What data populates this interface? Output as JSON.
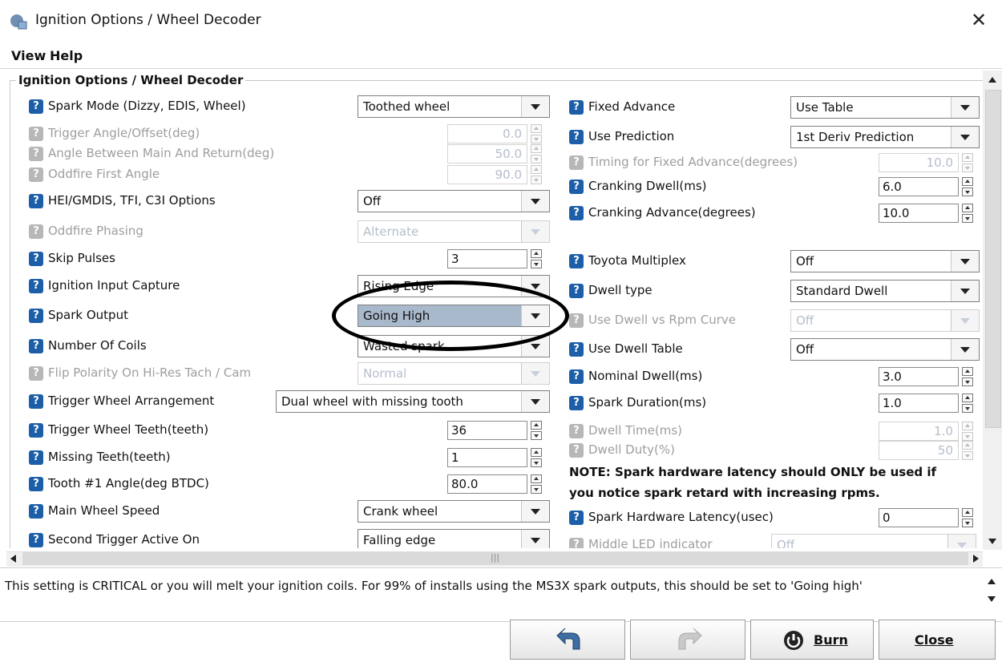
{
  "window": {
    "title": "Ignition Options / Wheel Decoder",
    "close_glyph": "✕"
  },
  "menu": [
    "View",
    "Help"
  ],
  "group_title": "Ignition Options / Wheel Decoder",
  "left": [
    {
      "label": "Spark Mode (Dizzy, EDIS, Wheel)",
      "type": "combo",
      "value": "Toothed wheel",
      "enabled": true
    },
    {
      "label": "Trigger Angle/Offset(deg)",
      "type": "spin",
      "value": "0.0",
      "enabled": false
    },
    {
      "label": "Angle Between Main And Return(deg)",
      "type": "spin",
      "value": "50.0",
      "enabled": false
    },
    {
      "label": "Oddfire First Angle",
      "type": "spin",
      "value": "90.0",
      "enabled": false
    },
    {
      "label": "HEI/GMDIS, TFI, C3I Options",
      "type": "combo",
      "value": "Off",
      "enabled": true
    },
    {
      "label": "Oddfire Phasing",
      "type": "combo",
      "value": "Alternate",
      "enabled": false
    },
    {
      "label": "Skip Pulses",
      "type": "spin",
      "value": "3",
      "enabled": true
    },
    {
      "label": "Ignition Input Capture",
      "type": "combo",
      "value": "Rising Edge",
      "enabled": true
    },
    {
      "label": "Spark Output",
      "type": "combo",
      "value": "Going High",
      "enabled": true
    },
    {
      "label": "Number Of Coils",
      "type": "combo",
      "value": "Wasted spark",
      "enabled": true
    },
    {
      "label": "Flip Polarity On Hi-Res Tach / Cam",
      "type": "combo",
      "value": "Normal",
      "enabled": false
    },
    {
      "label": "Trigger Wheel Arrangement",
      "type": "combo",
      "value": "Dual wheel with missing tooth",
      "enabled": true
    },
    {
      "label": "Trigger Wheel Teeth(teeth)",
      "type": "spin",
      "value": "36",
      "enabled": true
    },
    {
      "label": "Missing Teeth(teeth)",
      "type": "spin",
      "value": "1",
      "enabled": true
    },
    {
      "label": "Tooth #1 Angle(deg BTDC)",
      "type": "spin",
      "value": "80.0",
      "enabled": true
    },
    {
      "label": "Main Wheel Speed",
      "type": "combo",
      "value": "Crank wheel",
      "enabled": true
    },
    {
      "label": "Second Trigger Active On",
      "type": "combo",
      "value": "Falling edge",
      "enabled": true
    }
  ],
  "right": [
    {
      "label": "Fixed Advance",
      "type": "combo",
      "value": "Use Table",
      "enabled": true
    },
    {
      "label": "Use Prediction",
      "type": "combo",
      "value": "1st Deriv Prediction",
      "enabled": true
    },
    {
      "label": "Timing for Fixed Advance(degrees)",
      "type": "spin",
      "value": "10.0",
      "enabled": false
    },
    {
      "label": "Cranking Dwell(ms)",
      "type": "spin",
      "value": "6.0",
      "enabled": true
    },
    {
      "label": "Cranking Advance(degrees)",
      "type": "spin",
      "value": "10.0",
      "enabled": true
    },
    {
      "label": "Toyota Multiplex",
      "type": "combo",
      "value": "Off",
      "enabled": true
    },
    {
      "label": "Dwell type",
      "type": "combo",
      "value": "Standard Dwell",
      "enabled": true
    },
    {
      "label": "Use Dwell vs Rpm Curve",
      "type": "combo",
      "value": "Off",
      "enabled": false
    },
    {
      "label": "Use Dwell Table",
      "type": "combo",
      "value": "Off",
      "enabled": true
    },
    {
      "label": "Nominal Dwell(ms)",
      "type": "spin",
      "value": "3.0",
      "enabled": true
    },
    {
      "label": "Spark Duration(ms)",
      "type": "spin",
      "value": "1.0",
      "enabled": true
    },
    {
      "label": "Dwell Time(ms)",
      "type": "spin",
      "value": "1.0",
      "enabled": false
    },
    {
      "label": "Dwell Duty(%)",
      "type": "spin",
      "value": "50",
      "enabled": false
    },
    {
      "label": "Spark Hardware Latency(usec)",
      "type": "spin",
      "value": "0",
      "enabled": true
    },
    {
      "label": "Middle LED indicator",
      "type": "combo",
      "value": "Off",
      "enabled": false
    }
  ],
  "note": [
    "NOTE: Spark hardware latency should ONLY be used if",
    "you notice spark retard with increasing rpms."
  ],
  "help_text": "This setting is CRITICAL or you will melt your ignition coils. For 99% of installs using the MS3X spark outputs, this should be set to 'Going high'",
  "buttons": {
    "burn": "Burn",
    "close": "Close"
  },
  "hscroll_grip": "|||",
  "colors": {
    "help_icon": "#1c5fa8",
    "highlight_combo": "#a9b9cc",
    "annotation": "#000000"
  }
}
